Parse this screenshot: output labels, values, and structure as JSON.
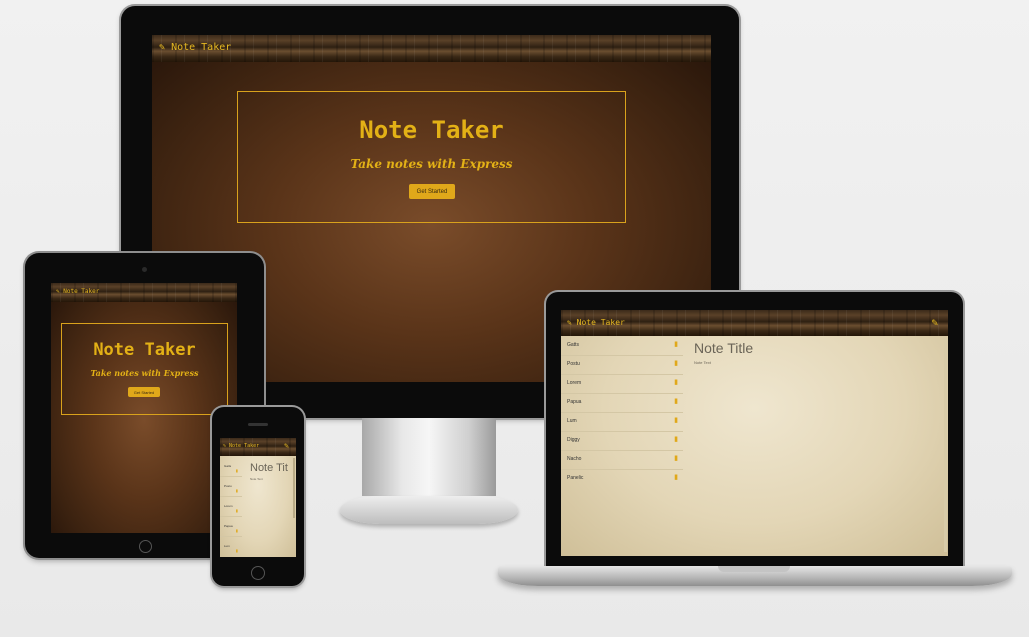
{
  "app": {
    "brand": "Note Taker",
    "hero_title": "Note Taker",
    "hero_subtitle": "Take notes with Express",
    "cta_label": "Get Started"
  },
  "notes_view": {
    "note_title": "Note Title",
    "note_text": "Note Text",
    "note_title_phone": "Note Tit",
    "notes": [
      "Gatts",
      "Postu",
      "Lorem",
      "Papua",
      "Lum",
      "Diggy",
      "Nacho",
      "Panelic"
    ]
  },
  "colors": {
    "accent": "#e0a81a",
    "page_bg": "#ececec",
    "bezel": "#0b0b0b"
  },
  "icons": {
    "brand": "pencil-icon",
    "new_note": "pencil-icon",
    "delete": "trash-icon"
  }
}
